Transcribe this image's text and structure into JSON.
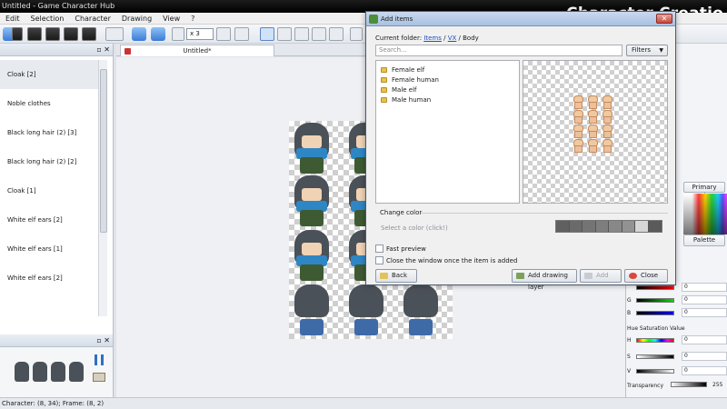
{
  "app": {
    "window_title": "Untitled - Game Character Hub",
    "overlay_title": "Character Creatio"
  },
  "menu": [
    "Edit",
    "Selection",
    "Character",
    "Drawing",
    "View",
    "?"
  ],
  "toolbar": {
    "zoom": "x 3"
  },
  "tabs": {
    "active": "Untitled*"
  },
  "layers": [
    "Cloak [2]",
    "Noble clothes",
    "Black long hair (2) [3]",
    "Black long hair (2) [2]",
    "Cloak [1]",
    "White elf ears [2]",
    "White elf ears [1]",
    "White elf ears [2]"
  ],
  "status": "Character: (8, 34); Frame: (8, 2)",
  "dialog": {
    "title": "Add items",
    "close_glyph": "✕",
    "path_label": "Current folder:",
    "path": [
      "Items",
      "VX",
      "Body"
    ],
    "path_sep": " / ",
    "search_placeholder": "Search...",
    "filters_label": "Filters",
    "folders": [
      "Female elf",
      "Female human",
      "Male elf",
      "Male human"
    ],
    "change_color_label": "Change color",
    "color_hint": "Select a color (click!)",
    "color_swatches": [
      "#606060",
      "#6a6a6a",
      "#747474",
      "#7e7e7e",
      "#888888",
      "#929292",
      "#d6d6d6",
      "#5a5a5a"
    ],
    "fast_preview": "Fast preview",
    "close_on_add": "Close the window once the item is added",
    "buttons": {
      "back": "Back",
      "add_layer": "Add drawing layer",
      "add": "Add",
      "close": "Close"
    }
  },
  "right_panel": {
    "primary_color": "Primary color",
    "palette": "Palette",
    "rgb": [
      {
        "label": "G",
        "value": "0"
      },
      {
        "label": "B",
        "value": "0"
      }
    ],
    "hsv_title": "Hue Saturation Value",
    "hsv": [
      {
        "label": "H",
        "value": "0"
      },
      {
        "label": "S",
        "value": "0"
      },
      {
        "label": "V",
        "value": "0"
      }
    ],
    "transparency_label": "Transparency",
    "transparency_value": "255",
    "r_value": "0"
  }
}
